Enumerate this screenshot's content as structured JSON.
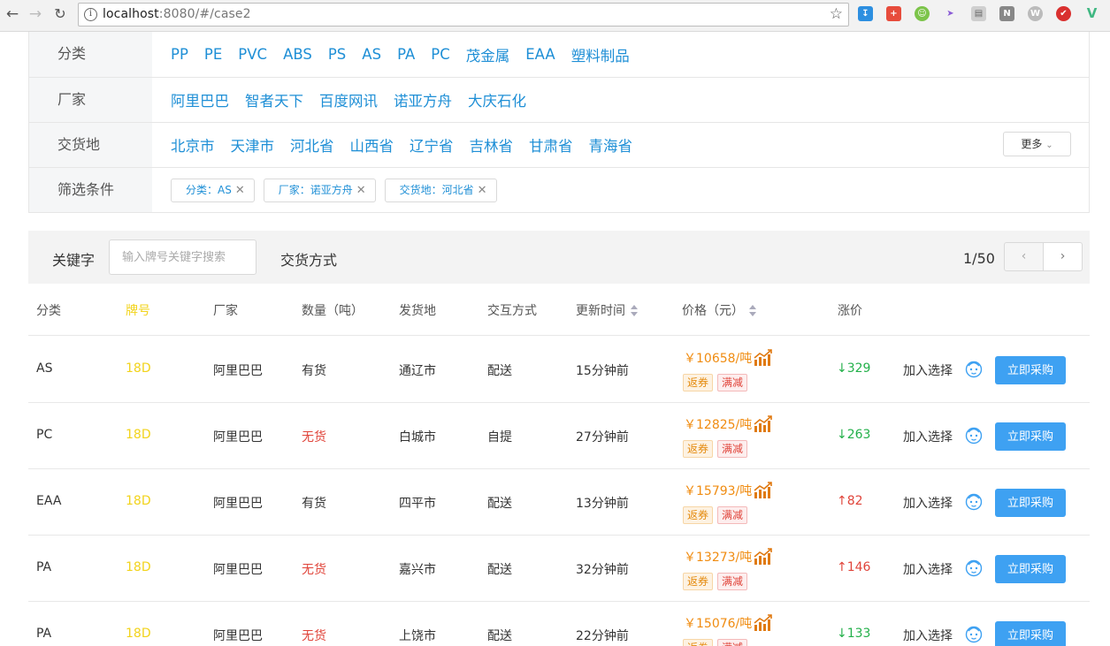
{
  "browser": {
    "url_host": "localhost",
    "url_rest": ":8080/#/case2"
  },
  "filters": {
    "category": {
      "label": "分类",
      "items": [
        "PP",
        "PE",
        "PVC",
        "ABS",
        "PS",
        "AS",
        "PA",
        "PC",
        "茂金属",
        "EAA",
        "塑料制品"
      ]
    },
    "manufacturer": {
      "label": "厂家",
      "items": [
        "阿里巴巴",
        "智者天下",
        "百度网讯",
        "诺亚方舟",
        "大庆石化"
      ]
    },
    "delivery_place": {
      "label": "交货地",
      "items": [
        "北京市",
        "天津市",
        "河北省",
        "山西省",
        "辽宁省",
        "吉林省",
        "甘肃省",
        "青海省"
      ],
      "more_label": "更多"
    },
    "conditions": {
      "label": "筛选条件",
      "tags": [
        "分类：AS",
        "厂家：诺亚方舟",
        "交货地：河北省"
      ]
    }
  },
  "search": {
    "keyword_label": "关键字",
    "placeholder": "输入牌号关键字搜索",
    "delivery_method_label": "交货方式",
    "pagination": "1/50"
  },
  "table": {
    "headers": [
      "分类",
      "牌号",
      "厂家",
      "数量（吨）",
      "发货地",
      "交互方式",
      "更新时间",
      "价格（元）",
      "涨价"
    ],
    "badge_rebate": "返券",
    "badge_discount": "满减",
    "add_label": "加入选择",
    "buy_label": "立即采购",
    "rows": [
      {
        "category": "AS",
        "brand": "18D",
        "maker": "阿里巴巴",
        "stock": "有货",
        "in_stock": true,
        "origin": "通辽市",
        "method": "配送",
        "updated": "15分钟前",
        "price": "￥10658/吨",
        "change": "↓329",
        "direction": "down"
      },
      {
        "category": "PC",
        "brand": "18D",
        "maker": "阿里巴巴",
        "stock": "无货",
        "in_stock": false,
        "origin": "白城市",
        "method": "自提",
        "updated": "27分钟前",
        "price": "￥12825/吨",
        "change": "↓263",
        "direction": "down"
      },
      {
        "category": "EAA",
        "brand": "18D",
        "maker": "阿里巴巴",
        "stock": "有货",
        "in_stock": true,
        "origin": "四平市",
        "method": "配送",
        "updated": "13分钟前",
        "price": "￥15793/吨",
        "change": "↑82",
        "direction": "up"
      },
      {
        "category": "PA",
        "brand": "18D",
        "maker": "阿里巴巴",
        "stock": "无货",
        "in_stock": false,
        "origin": "嘉兴市",
        "method": "配送",
        "updated": "32分钟前",
        "price": "￥13273/吨",
        "change": "↑146",
        "direction": "up"
      },
      {
        "category": "PA",
        "brand": "18D",
        "maker": "阿里巴巴",
        "stock": "无货",
        "in_stock": false,
        "origin": "上饶市",
        "method": "配送",
        "updated": "22分钟前",
        "price": "￥15076/吨",
        "change": "↓133",
        "direction": "down"
      }
    ]
  },
  "colors": {
    "link_blue": "#1f8fd6",
    "brand_yellow": "#f2d31b",
    "price_orange": "#f08c11",
    "down_green": "#23b04a",
    "up_red": "#e0443a",
    "buy_button": "#3ea1f2"
  }
}
